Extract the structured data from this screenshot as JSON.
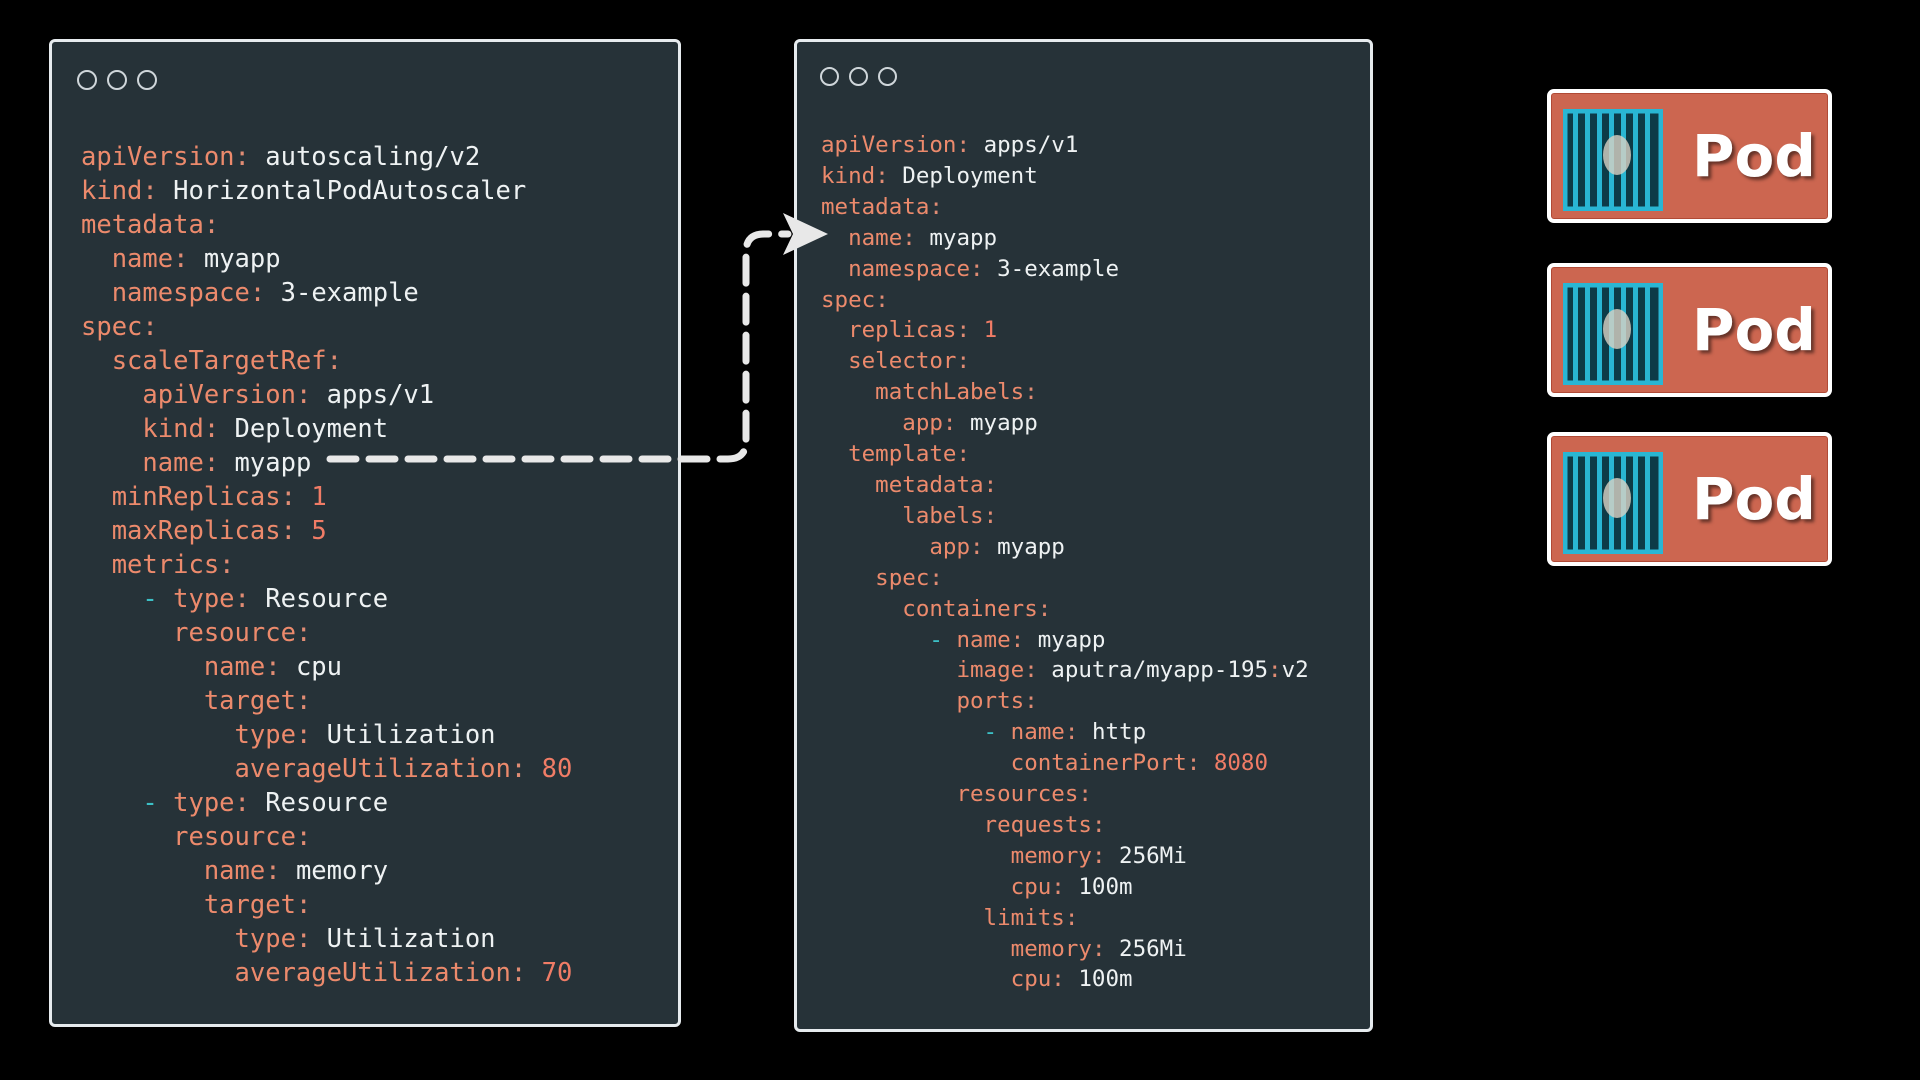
{
  "hpa_yaml": {
    "lines": [
      [
        {
          "t": "apiVersion",
          "c": "k"
        },
        {
          "t": ": ",
          "c": "c"
        },
        {
          "t": "autoscaling/v2",
          "c": "v"
        }
      ],
      [
        {
          "t": "kind",
          "c": "k"
        },
        {
          "t": ": ",
          "c": "c"
        },
        {
          "t": "HorizontalPodAutoscaler",
          "c": "v"
        }
      ],
      [
        {
          "t": "metadata",
          "c": "k"
        },
        {
          "t": ":",
          "c": "c"
        }
      ],
      [
        {
          "t": "  name",
          "c": "k"
        },
        {
          "t": ": ",
          "c": "c"
        },
        {
          "t": "myapp",
          "c": "v"
        }
      ],
      [
        {
          "t": "  namespace",
          "c": "k"
        },
        {
          "t": ": ",
          "c": "c"
        },
        {
          "t": "3-example",
          "c": "v"
        }
      ],
      [
        {
          "t": "spec",
          "c": "k"
        },
        {
          "t": ":",
          "c": "c"
        }
      ],
      [
        {
          "t": "  scaleTargetRef",
          "c": "k"
        },
        {
          "t": ":",
          "c": "c"
        }
      ],
      [
        {
          "t": "    apiVersion",
          "c": "k"
        },
        {
          "t": ": ",
          "c": "c"
        },
        {
          "t": "apps/v1",
          "c": "v"
        }
      ],
      [
        {
          "t": "    kind",
          "c": "k"
        },
        {
          "t": ": ",
          "c": "c"
        },
        {
          "t": "Deployment",
          "c": "v"
        }
      ],
      [
        {
          "t": "    name",
          "c": "k"
        },
        {
          "t": ": ",
          "c": "c"
        },
        {
          "t": "myapp",
          "c": "v"
        }
      ],
      [
        {
          "t": "  minReplicas",
          "c": "k"
        },
        {
          "t": ": ",
          "c": "c"
        },
        {
          "t": "1",
          "c": "n"
        }
      ],
      [
        {
          "t": "  maxReplicas",
          "c": "k"
        },
        {
          "t": ": ",
          "c": "c"
        },
        {
          "t": "5",
          "c": "n"
        }
      ],
      [
        {
          "t": "  metrics",
          "c": "k"
        },
        {
          "t": ":",
          "c": "c"
        }
      ],
      [
        {
          "t": "    - ",
          "c": "d"
        },
        {
          "t": "type",
          "c": "k"
        },
        {
          "t": ": ",
          "c": "c"
        },
        {
          "t": "Resource",
          "c": "v"
        }
      ],
      [
        {
          "t": "      resource",
          "c": "k"
        },
        {
          "t": ":",
          "c": "c"
        }
      ],
      [
        {
          "t": "        name",
          "c": "k"
        },
        {
          "t": ": ",
          "c": "c"
        },
        {
          "t": "cpu",
          "c": "v"
        }
      ],
      [
        {
          "t": "        target",
          "c": "k"
        },
        {
          "t": ":",
          "c": "c"
        }
      ],
      [
        {
          "t": "          type",
          "c": "k"
        },
        {
          "t": ": ",
          "c": "c"
        },
        {
          "t": "Utilization",
          "c": "v"
        }
      ],
      [
        {
          "t": "          averageUtilization",
          "c": "k"
        },
        {
          "t": ": ",
          "c": "c"
        },
        {
          "t": "80",
          "c": "n"
        }
      ],
      [
        {
          "t": "    - ",
          "c": "d"
        },
        {
          "t": "type",
          "c": "k"
        },
        {
          "t": ": ",
          "c": "c"
        },
        {
          "t": "Resource",
          "c": "v"
        }
      ],
      [
        {
          "t": "      resource",
          "c": "k"
        },
        {
          "t": ":",
          "c": "c"
        }
      ],
      [
        {
          "t": "        name",
          "c": "k"
        },
        {
          "t": ": ",
          "c": "c"
        },
        {
          "t": "memory",
          "c": "v"
        }
      ],
      [
        {
          "t": "        target",
          "c": "k"
        },
        {
          "t": ":",
          "c": "c"
        }
      ],
      [
        {
          "t": "          type",
          "c": "k"
        },
        {
          "t": ": ",
          "c": "c"
        },
        {
          "t": "Utilization",
          "c": "v"
        }
      ],
      [
        {
          "t": "          averageUtilization",
          "c": "k"
        },
        {
          "t": ": ",
          "c": "c"
        },
        {
          "t": "70",
          "c": "n"
        }
      ]
    ]
  },
  "deployment_yaml": {
    "lines": [
      [
        {
          "t": "apiVersion",
          "c": "k"
        },
        {
          "t": ": ",
          "c": "c"
        },
        {
          "t": "apps/v1",
          "c": "v"
        }
      ],
      [
        {
          "t": "kind",
          "c": "k"
        },
        {
          "t": ": ",
          "c": "c"
        },
        {
          "t": "Deployment",
          "c": "v"
        }
      ],
      [
        {
          "t": "metadata",
          "c": "k"
        },
        {
          "t": ":",
          "c": "c"
        }
      ],
      [
        {
          "t": "  name",
          "c": "k"
        },
        {
          "t": ": ",
          "c": "c"
        },
        {
          "t": "myapp",
          "c": "v"
        }
      ],
      [
        {
          "t": "  namespace",
          "c": "k"
        },
        {
          "t": ": ",
          "c": "c"
        },
        {
          "t": "3-example",
          "c": "v"
        }
      ],
      [
        {
          "t": "spec",
          "c": "k"
        },
        {
          "t": ":",
          "c": "c"
        }
      ],
      [
        {
          "t": "  replicas",
          "c": "k"
        },
        {
          "t": ": ",
          "c": "c"
        },
        {
          "t": "1",
          "c": "n"
        }
      ],
      [
        {
          "t": "  selector",
          "c": "k"
        },
        {
          "t": ":",
          "c": "c"
        }
      ],
      [
        {
          "t": "    matchLabels",
          "c": "k"
        },
        {
          "t": ":",
          "c": "c"
        }
      ],
      [
        {
          "t": "      app",
          "c": "k"
        },
        {
          "t": ": ",
          "c": "c"
        },
        {
          "t": "myapp",
          "c": "v"
        }
      ],
      [
        {
          "t": "  template",
          "c": "k"
        },
        {
          "t": ":",
          "c": "c"
        }
      ],
      [
        {
          "t": "    metadata",
          "c": "k"
        },
        {
          "t": ":",
          "c": "c"
        }
      ],
      [
        {
          "t": "      labels",
          "c": "k"
        },
        {
          "t": ":",
          "c": "c"
        }
      ],
      [
        {
          "t": "        app",
          "c": "k"
        },
        {
          "t": ": ",
          "c": "c"
        },
        {
          "t": "myapp",
          "c": "v"
        }
      ],
      [
        {
          "t": "    spec",
          "c": "k"
        },
        {
          "t": ":",
          "c": "c"
        }
      ],
      [
        {
          "t": "      containers",
          "c": "k"
        },
        {
          "t": ":",
          "c": "c"
        }
      ],
      [
        {
          "t": "        - ",
          "c": "d"
        },
        {
          "t": "name",
          "c": "k"
        },
        {
          "t": ": ",
          "c": "c"
        },
        {
          "t": "myapp",
          "c": "v"
        }
      ],
      [
        {
          "t": "          image",
          "c": "k"
        },
        {
          "t": ": ",
          "c": "c"
        },
        {
          "t": "aputra/myapp-195",
          "c": "v"
        },
        {
          "t": ":",
          "c": "c"
        },
        {
          "t": "v2",
          "c": "v"
        }
      ],
      [
        {
          "t": "          ports",
          "c": "k"
        },
        {
          "t": ":",
          "c": "c"
        }
      ],
      [
        {
          "t": "            - ",
          "c": "d"
        },
        {
          "t": "name",
          "c": "k"
        },
        {
          "t": ": ",
          "c": "c"
        },
        {
          "t": "http",
          "c": "v"
        }
      ],
      [
        {
          "t": "              containerPort",
          "c": "k"
        },
        {
          "t": ": ",
          "c": "c"
        },
        {
          "t": "8080",
          "c": "n"
        }
      ],
      [
        {
          "t": "          resources",
          "c": "k"
        },
        {
          "t": ":",
          "c": "c"
        }
      ],
      [
        {
          "t": "            requests",
          "c": "k"
        },
        {
          "t": ":",
          "c": "c"
        }
      ],
      [
        {
          "t": "              memory",
          "c": "k"
        },
        {
          "t": ": ",
          "c": "c"
        },
        {
          "t": "256Mi",
          "c": "v"
        }
      ],
      [
        {
          "t": "              cpu",
          "c": "k"
        },
        {
          "t": ": ",
          "c": "c"
        },
        {
          "t": "100m",
          "c": "v"
        }
      ],
      [
        {
          "t": "            limits",
          "c": "k"
        },
        {
          "t": ":",
          "c": "c"
        }
      ],
      [
        {
          "t": "              memory",
          "c": "k"
        },
        {
          "t": ": ",
          "c": "c"
        },
        {
          "t": "256Mi",
          "c": "v"
        }
      ],
      [
        {
          "t": "              cpu",
          "c": "k"
        },
        {
          "t": ": ",
          "c": "c"
        },
        {
          "t": "100m",
          "c": "v"
        }
      ]
    ]
  },
  "pods": [
    {
      "label": "Pod",
      "icon": "pod-cage-icon"
    },
    {
      "label": "Pod",
      "icon": "pod-cage-icon"
    },
    {
      "label": "Pod",
      "icon": "pod-cage-icon"
    }
  ],
  "colors": {
    "background": "#000000",
    "window_bg": "#263238",
    "window_border": "#e6ebee",
    "yaml_key": "#ec8a6c",
    "yaml_value": "#eef2f3",
    "yaml_number": "#f07c66",
    "yaml_dash": "#3cc0c6",
    "pod_fill": "#cc6650",
    "pod_icon": "#29b6d3"
  }
}
